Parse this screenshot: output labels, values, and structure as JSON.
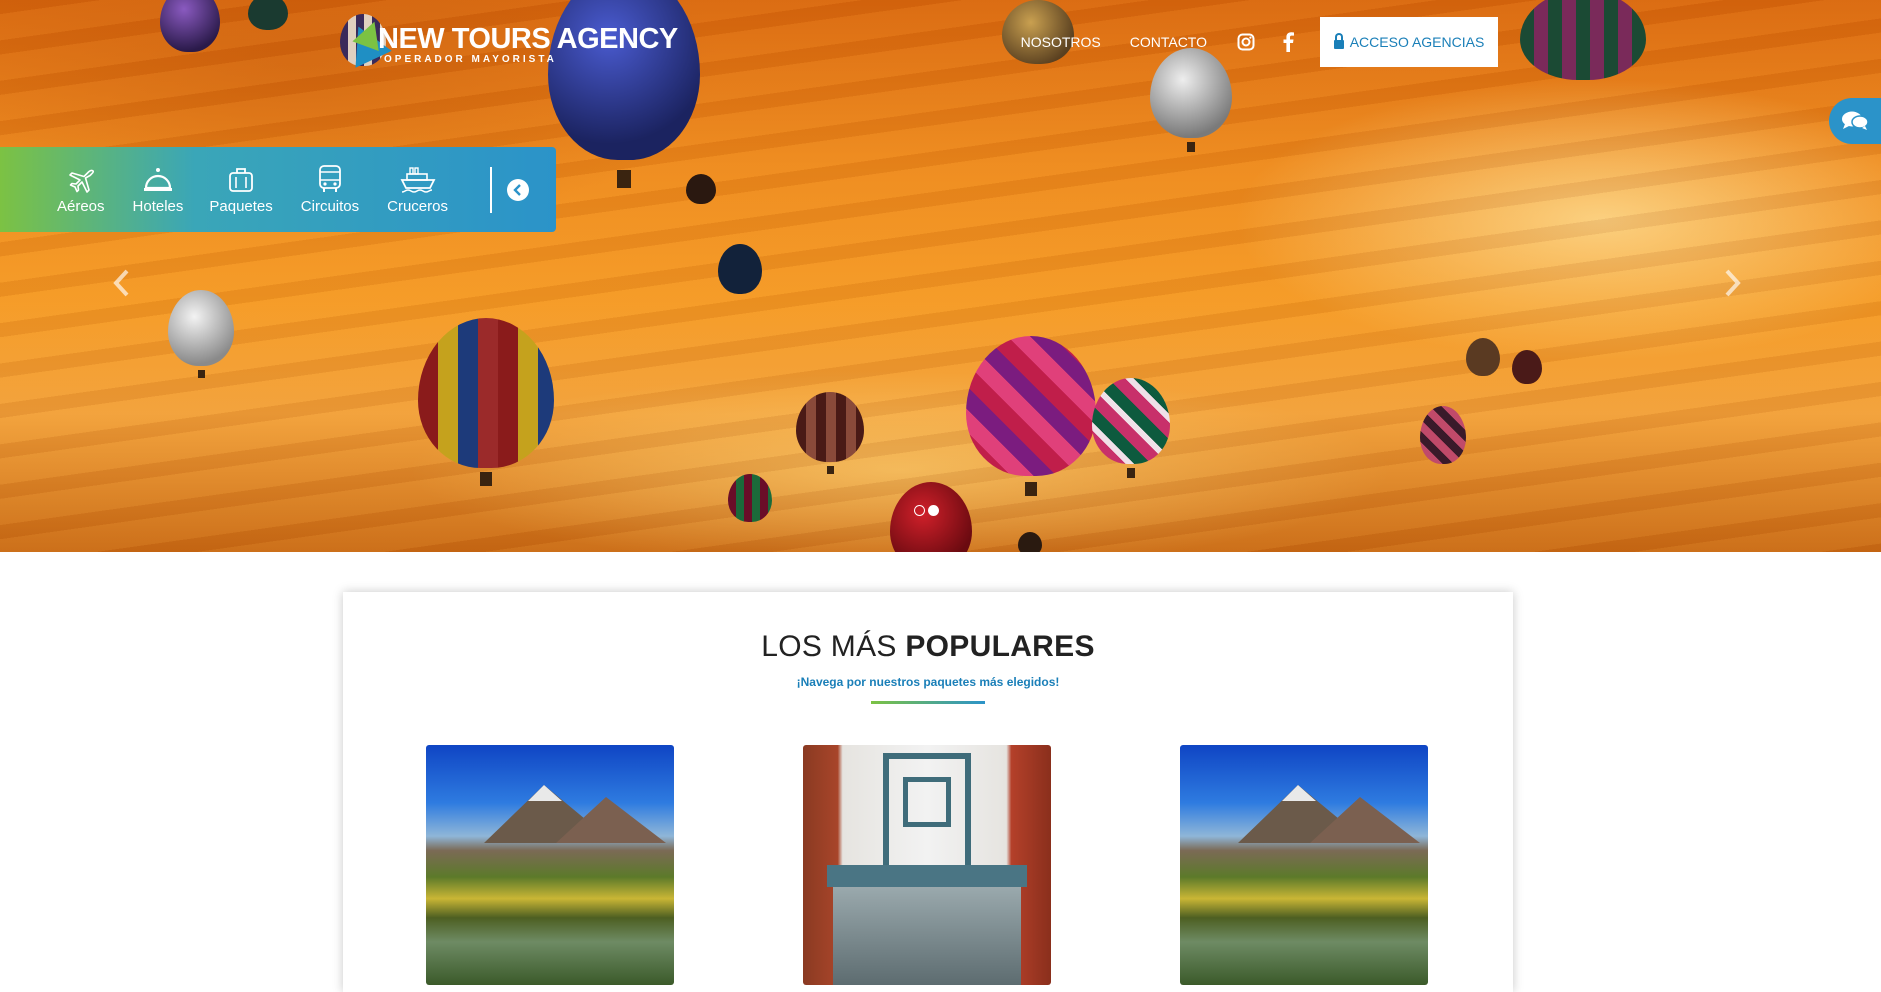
{
  "brand": {
    "name": "NEW TOURS AGENCY",
    "tagline": "OPERADOR MAYORISTA"
  },
  "nav": {
    "links": [
      "NOSOTROS",
      "CONTACTO"
    ],
    "instagram_icon": "instagram-icon",
    "facebook_icon": "facebook-icon",
    "acceso_label": "ACCESO AGENCIAS",
    "acceso_icon": "lock-icon"
  },
  "search_tabs": [
    {
      "label": "Aéreos",
      "icon": "airplane-icon"
    },
    {
      "label": "Hoteles",
      "icon": "bell-icon"
    },
    {
      "label": "Paquetes",
      "icon": "suitcase-icon"
    },
    {
      "label": "Circuitos",
      "icon": "bus-icon"
    },
    {
      "label": "Cruceros",
      "icon": "ship-icon"
    }
  ],
  "slider": {
    "slides": 2,
    "active_slide": 2
  },
  "popular": {
    "title_light": "LOS MÁS",
    "title_bold": "POPULARES",
    "subtitle": "¡Navega por nuestros paquetes más elegidos!",
    "cards": [
      {
        "image": "mountain-lake"
      },
      {
        "image": "city-bridge"
      },
      {
        "image": "mountain-lake"
      }
    ]
  },
  "colors": {
    "primary_blue": "#2b93c9",
    "accent_green": "#7cc243",
    "text_blue": "#1a7fb8"
  }
}
